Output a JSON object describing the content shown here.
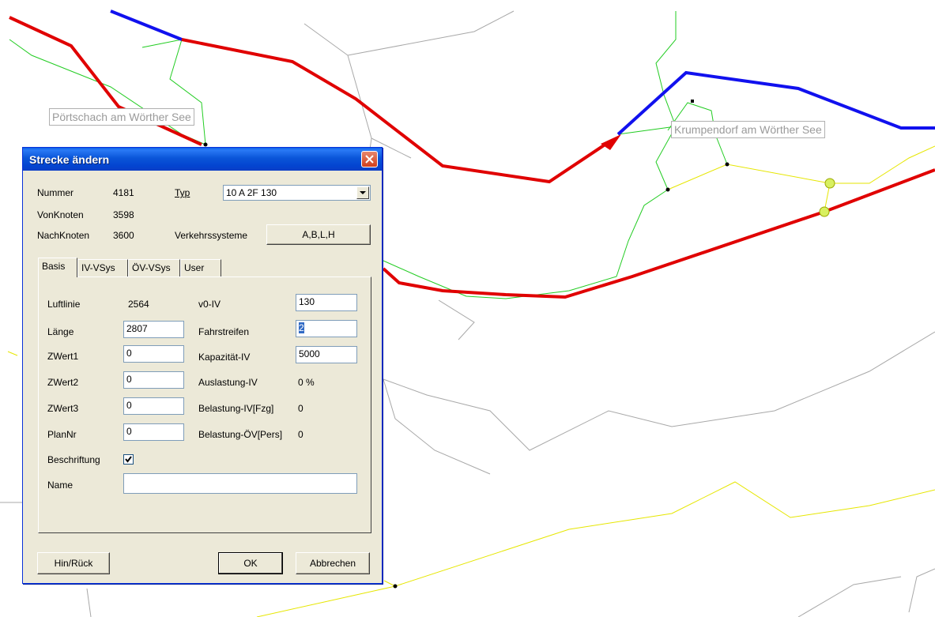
{
  "map": {
    "labels": [
      "Pörtschach am Wörther See",
      "Krumpendorf am Wörther See"
    ],
    "colors": {
      "red": "#e00000",
      "blue": "#1111ee",
      "green": "#22cc22",
      "yellow": "#e6e600",
      "gray": "#a8a8a8",
      "node_yellow": "#d8f060"
    }
  },
  "dialog": {
    "title": "Strecke ändern",
    "close_icon": "close-icon",
    "header": {
      "nummer_label": "Nummer",
      "nummer_value": "4181",
      "vonknoten_label": "VonKnoten",
      "vonknoten_value": "3598",
      "nachknoten_label": "NachKnoten",
      "nachknoten_value": "3600",
      "typ_label": "Typ",
      "typ_value": "10  A 2F 130",
      "verkehrssysteme_label": "Verkehrssysteme",
      "verkehrssysteme_value": "A,B,L,H"
    },
    "tabs": [
      "Basis",
      "IV-VSys",
      "ÖV-VSys",
      "User"
    ],
    "basis": {
      "luftlinie_label": "Luftlinie",
      "luftlinie_value": "2564",
      "laenge_label": "Länge",
      "laenge_value": "2807",
      "zwert1_label": "ZWert1",
      "zwert1_value": "0",
      "zwert2_label": "ZWert2",
      "zwert2_value": "0",
      "zwert3_label": "ZWert3",
      "zwert3_value": "0",
      "plannr_label": "PlanNr",
      "plannr_value": "0",
      "beschriftung_label": "Beschriftung",
      "name_label": "Name",
      "name_value": "",
      "v0iv_label": "v0-IV",
      "v0iv_value": "130",
      "fahrstreifen_label": "Fahrstreifen",
      "fahrstreifen_value": "2",
      "kapazitaet_label": "Kapazität-IV",
      "kapazitaet_value": "5000",
      "auslastung_label": "Auslastung-IV",
      "auslastung_value": "0 %",
      "belastung_iv_label": "Belastung-IV[Fzg]",
      "belastung_iv_value": "0",
      "belastung_ov_label": "Belastung-ÖV[Pers]",
      "belastung_ov_value": "0"
    },
    "buttons": {
      "hinrueck": "Hin/Rück",
      "ok": "OK",
      "abbrechen": "Abbrechen"
    }
  }
}
